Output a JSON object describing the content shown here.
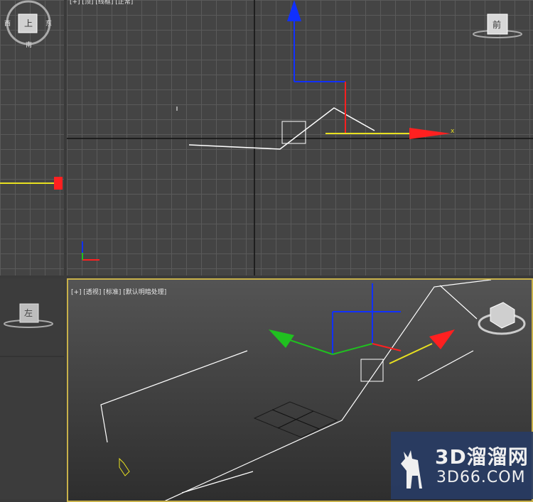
{
  "viewports": {
    "top_main": {
      "label": "[+] [顶] [线框] [正常]"
    },
    "top_left": {
      "navcube_center": "上",
      "navcube_east": "东",
      "navcube_west": "西",
      "navcube_south": "南"
    },
    "top_right_cube": {
      "face": "前"
    },
    "bottom_left": {
      "cube_face": "左"
    },
    "perspective": {
      "label": "[+] [透视] [标准] [默认明暗处理]"
    }
  },
  "axis_labels": {
    "x": "x"
  },
  "watermark": {
    "cn": "3D溜溜网",
    "en": "3D66.COM"
  },
  "colors": {
    "viewport_border_active": "#c8b14a",
    "axis_x": "#ff2020",
    "axis_y": "#20c020",
    "axis_z": "#1030ff",
    "gizmo_yellow": "#e8e020",
    "grid_line": "#5a5a5a"
  }
}
